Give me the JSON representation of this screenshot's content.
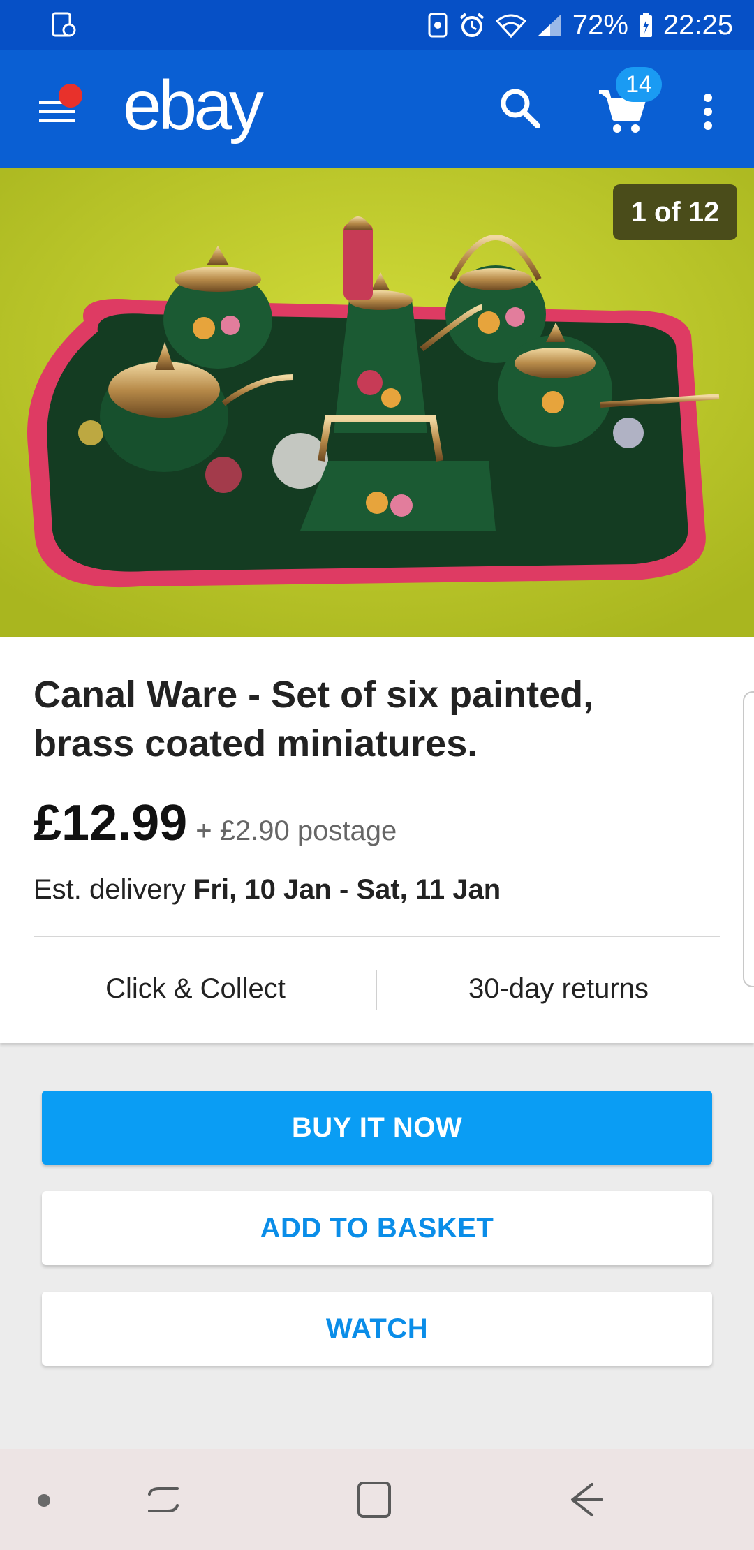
{
  "status_bar": {
    "battery": "72%",
    "time": "22:25",
    "icons": [
      "screenshot-icon",
      "data-saver-icon",
      "alarm-icon",
      "wifi-icon",
      "signal-icon",
      "battery-icon"
    ]
  },
  "app_bar": {
    "logo": "ebay",
    "cart_count": "14",
    "icons": [
      "menu-icon",
      "search-icon",
      "cart-icon",
      "overflow-menu-icon"
    ]
  },
  "gallery": {
    "counter": "1 of 12",
    "image": "photo of a painted miniature tea set on a red-rimmed tray"
  },
  "listing": {
    "title": "Canal Ware - Set of six painted, brass coated miniatures.",
    "price": "£12.99",
    "postage": "+ £2.90 postage",
    "delivery_label": "Est. delivery",
    "delivery_dates": "Fri, 10 Jan - Sat, 11 Jan",
    "features": [
      "Click & Collect",
      "30-day returns"
    ]
  },
  "actions": {
    "buy_now": "BUY IT NOW",
    "add_to_basket": "ADD TO BASKET",
    "watch": "WATCH"
  },
  "colors": {
    "status_bar": "#0650c6",
    "app_bar": "#0a5fd3",
    "primary_button": "#0a9df4",
    "link_text": "#0a8de8",
    "notification_dot": "#e8312b"
  },
  "nav_bar": {
    "icons": [
      "nav-dot-icon",
      "recents-icon",
      "home-icon",
      "back-icon"
    ]
  }
}
